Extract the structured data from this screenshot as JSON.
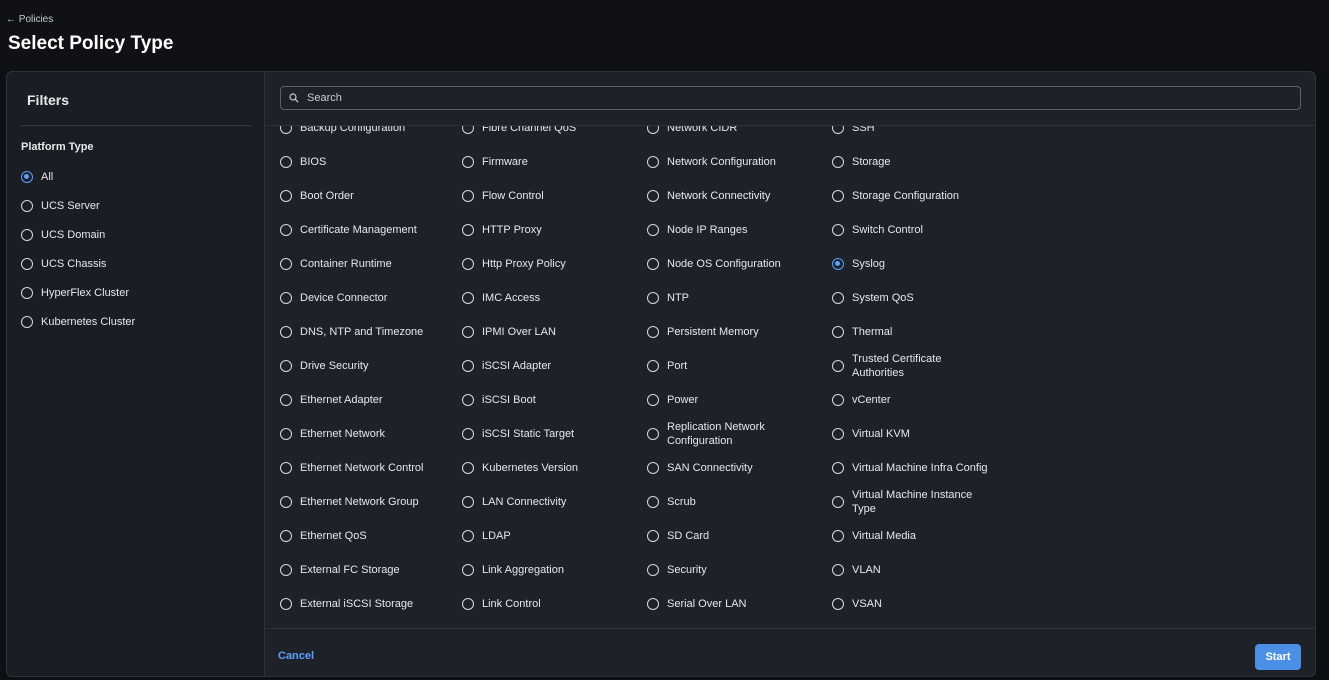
{
  "header": {
    "back_label": "← Policies",
    "title": "Select Policy Type"
  },
  "filters": {
    "title": "Filters",
    "platform_type_label": "Platform Type",
    "options": [
      {
        "label": "All",
        "selected": true
      },
      {
        "label": "UCS Server",
        "selected": false
      },
      {
        "label": "UCS Domain",
        "selected": false
      },
      {
        "label": "UCS Chassis",
        "selected": false
      },
      {
        "label": "HyperFlex Cluster",
        "selected": false
      },
      {
        "label": "Kubernetes Cluster",
        "selected": false
      }
    ]
  },
  "search": {
    "placeholder": "Search",
    "value": ""
  },
  "policy_columns": [
    [
      "Backup Configuration",
      "BIOS",
      "Boot Order",
      "Certificate Management",
      "Container Runtime",
      "Device Connector",
      "DNS, NTP and Timezone",
      "Drive Security",
      "Ethernet Adapter",
      "Ethernet Network",
      "Ethernet Network Control",
      "Ethernet Network Group",
      "Ethernet QoS",
      "External FC Storage",
      "External iSCSI Storage"
    ],
    [
      "Fibre Channel QoS",
      "Firmware",
      "Flow Control",
      "HTTP Proxy",
      "Http Proxy Policy",
      "IMC Access",
      "IPMI Over LAN",
      "iSCSI Adapter",
      "iSCSI Boot",
      "iSCSI Static Target",
      "Kubernetes Version",
      "LAN Connectivity",
      "LDAP",
      "Link Aggregation",
      "Link Control"
    ],
    [
      "Network CIDR",
      "Network Configuration",
      "Network Connectivity",
      "Node IP Ranges",
      "Node OS Configuration",
      "NTP",
      "Persistent Memory",
      "Port",
      "Power",
      "Replication Network Configuration",
      "SAN Connectivity",
      "Scrub",
      "SD Card",
      "Security",
      "Serial Over LAN"
    ],
    [
      "SSH",
      "Storage",
      "Storage Configuration",
      "Switch Control",
      "Syslog",
      "System QoS",
      "Thermal",
      "Trusted Certificate Authorities",
      "vCenter",
      "Virtual KVM",
      "Virtual Machine Infra Config",
      "Virtual Machine Instance Type",
      "Virtual Media",
      "VLAN",
      "VSAN"
    ]
  ],
  "selected_policy": "Syslog",
  "footer": {
    "cancel_label": "Cancel",
    "start_label": "Start"
  },
  "colors": {
    "accent": "#5aa0ff",
    "start_button": "#4b8fe6",
    "background": "#0d0f12",
    "panel": "#1e2228"
  },
  "icons": {
    "search": "search-icon",
    "radio": "radio-icon"
  }
}
